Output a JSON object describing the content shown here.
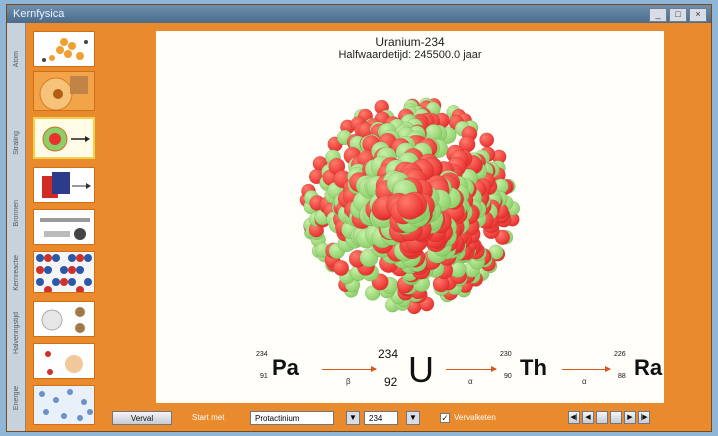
{
  "window": {
    "title": "Kernfysica",
    "buttons": [
      "_",
      "□",
      "×"
    ]
  },
  "side_tabs": [
    "Atom",
    "Straling",
    "Bronnen",
    "Kernreactie",
    "Halveringstijd",
    "Energie"
  ],
  "nuclide": {
    "name": "Uranium-234",
    "half_life": "Halfwaardetijd: 245500.0 jaar"
  },
  "decay_chain": [
    {
      "symbol": "Pa",
      "mass": "234",
      "atomic": "91"
    },
    {
      "symbol": "U",
      "mass": "234",
      "atomic": "92"
    },
    {
      "symbol": "Th",
      "mass": "230",
      "atomic": "90"
    },
    {
      "symbol": "Ra",
      "mass": "226",
      "atomic": "88"
    }
  ],
  "decay_labels": [
    "β",
    "α",
    "α"
  ],
  "controls": {
    "decay_button": "Verval",
    "start_label": "Start met",
    "element_value": "Protactinium",
    "mass_value": "234",
    "checkbox_label": "Vervalketen",
    "checkbox_checked": true
  },
  "nav_buttons": [
    "◀|",
    "◀",
    "",
    "",
    "▶",
    "|▶"
  ],
  "colors": {
    "proton": "#e8312f",
    "neutron": "#8ccf68",
    "window_bg": "#e98a2c"
  }
}
